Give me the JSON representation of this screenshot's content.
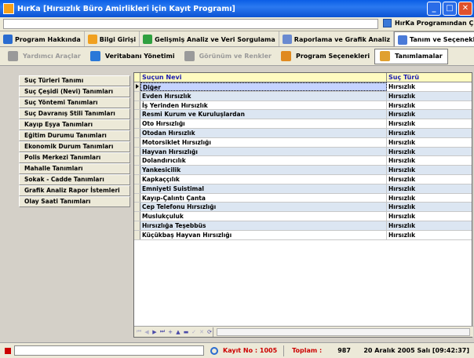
{
  "window": {
    "title": "HırKa [Hırsızlık Büro Amirlikleri için Kayıt Programı]"
  },
  "topbar": {
    "exit_label": "HırKa Programından Çık"
  },
  "menu": [
    {
      "label": "Program Hakkında",
      "icon": "help-icon",
      "color": "#2a6cd0"
    },
    {
      "label": "Bilgi Girişi",
      "icon": "data-entry-icon",
      "color": "#f0a020"
    },
    {
      "label": "Gelişmiş Analiz ve Veri Sorgulama",
      "icon": "analysis-icon",
      "color": "#30a040"
    },
    {
      "label": "Raporlama ve Grafik Analiz",
      "icon": "report-icon",
      "color": "#6a8ad0"
    },
    {
      "label": "Tanım ve Seçenekler",
      "icon": "settings-list-icon",
      "color": "#4a7ad8"
    }
  ],
  "toolbar": [
    {
      "label": "Yardımcı Araçlar",
      "icon": "tools-icon",
      "disabled": true,
      "color": "#9a9a9a"
    },
    {
      "label": "Veritabanı Yönetimi",
      "icon": "database-icon",
      "disabled": false,
      "color": "#2a78d8"
    },
    {
      "label": "Görünüm ve Renkler",
      "icon": "palette-icon",
      "disabled": true,
      "color": "#9a9a9a"
    },
    {
      "label": "Program Seçenekleri",
      "icon": "options-icon",
      "disabled": false,
      "color": "#e08a20"
    },
    {
      "label": "Tanımlamalar",
      "icon": "definitions-icon",
      "disabled": false,
      "color": "#e0a030"
    }
  ],
  "sidebar": [
    "Suç Türleri Tanımı",
    "Suç Çeşidi (Nevi) Tanımları",
    "Suç Yöntemi Tanımları",
    "Suç Davranış Stili Tanımları",
    "Kayıp Eşya Tanımları",
    "Eğitim Durumu Tanımları",
    "Ekonomik Durum Tanımları",
    "Polis Merkezi Tanımları",
    "Mahalle Tanımları",
    "Sokak - Cadde Tanımları",
    "Grafik Analiz Rapor İstemleri",
    "Olay Saati Tanımları"
  ],
  "grid": {
    "headers": {
      "col1": "Suçun Nevi",
      "col2": "Suç Türü"
    },
    "rows": [
      {
        "nevi": "Diğer",
        "tur": "Hırsızlık"
      },
      {
        "nevi": "Evden Hırsızlık",
        "tur": "Hırsızlık"
      },
      {
        "nevi": "İş Yerinden Hırsızlık",
        "tur": "Hırsızlık"
      },
      {
        "nevi": "Resmi Kurum ve Kuruluşlardan",
        "tur": "Hırsızlık"
      },
      {
        "nevi": "Oto Hırsızlığı",
        "tur": "Hırsızlık"
      },
      {
        "nevi": "Otodan Hırsızlık",
        "tur": "Hırsızlık"
      },
      {
        "nevi": "Motorsiklet Hırsızlığı",
        "tur": "Hırsızlık"
      },
      {
        "nevi": "Hayvan Hırsızlığı",
        "tur": "Hırsızlık"
      },
      {
        "nevi": "Dolandırıcılık",
        "tur": "Hırsızlık"
      },
      {
        "nevi": "Yankesicilik",
        "tur": "Hırsızlık"
      },
      {
        "nevi": "Kapkaççılık",
        "tur": "Hırsızlık"
      },
      {
        "nevi": "Emniyeti Suistimal",
        "tur": "Hırsızlık"
      },
      {
        "nevi": "Kayıp-Çalıntı Çanta",
        "tur": "Hırsızlık"
      },
      {
        "nevi": "Cep Telefonu Hırsızlığı",
        "tur": "Hırsızlık"
      },
      {
        "nevi": "Muslukçuluk",
        "tur": "Hırsızlık"
      },
      {
        "nevi": "Hırsızlığa Teşebbüs",
        "tur": "Hırsızlık"
      },
      {
        "nevi": "Küçükbaş Hayvan Hırsızlığı",
        "tur": "Hırsızlık"
      }
    ]
  },
  "navigator": {
    "buttons": [
      {
        "name": "nav-first-button",
        "glyph": "⏮",
        "disabled": true
      },
      {
        "name": "nav-prev-button",
        "glyph": "◀",
        "disabled": true
      },
      {
        "name": "nav-next-button",
        "glyph": "▶",
        "disabled": false
      },
      {
        "name": "nav-last-button",
        "glyph": "⏭",
        "disabled": false
      },
      {
        "name": "nav-insert-button",
        "glyph": "+",
        "disabled": false
      },
      {
        "name": "nav-delete-button",
        "glyph": "▲",
        "disabled": false
      },
      {
        "name": "nav-edit-button",
        "glyph": "▬",
        "disabled": false
      },
      {
        "name": "nav-post-button",
        "glyph": "✓",
        "disabled": true
      },
      {
        "name": "nav-cancel-button",
        "glyph": "✕",
        "disabled": true
      },
      {
        "name": "nav-refresh-button",
        "glyph": "⟳",
        "disabled": false
      }
    ]
  },
  "status": {
    "kayit_label": "Kayıt No : 1005",
    "toplam_label": "Toplam :",
    "toplam_value": "987",
    "date": "20 Aralık 2005 Salı [09:42:37]"
  }
}
